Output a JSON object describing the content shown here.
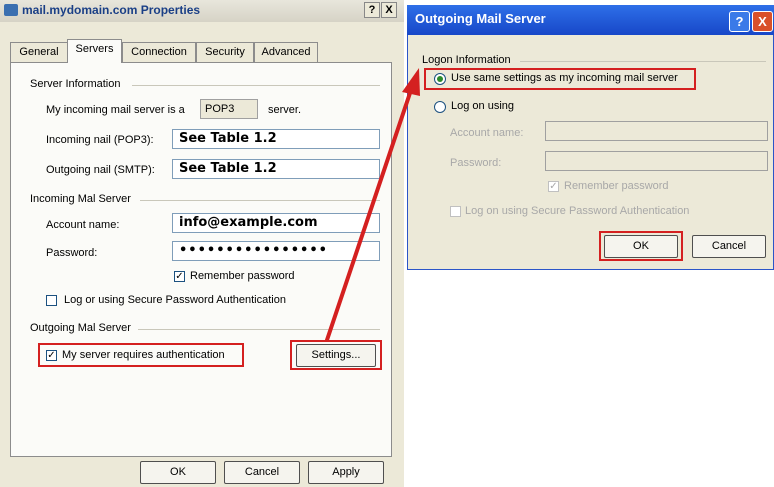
{
  "properties_dialog": {
    "title": "mail.mydomain.com Properties",
    "help_btn": "?",
    "close_btn": "X",
    "tabs": [
      "General",
      "Servers",
      "Connection",
      "Security",
      "Advanced"
    ],
    "active_tab": "Servers",
    "server_info": {
      "group": "Server Information",
      "incoming_type_prefix": "My incoming mail server is a",
      "incoming_type": "POP3",
      "incoming_type_suffix": "server.",
      "incoming_label": "Incoming nail (POP3):",
      "incoming_value": "See Table 1.2",
      "outgoing_label": "Outgoing nail (SMTP):",
      "outgoing_value": "See Table 1.2"
    },
    "incoming_server": {
      "group": "Incoming Mal Server",
      "account_label": "Account name:",
      "account_value": "info@example.com",
      "password_label": "Password:",
      "password_value": "••••••••••••••••",
      "remember_label": "Remember password",
      "remember_checked": true,
      "spa_label": "Log or using Secure Password Authentication",
      "spa_checked": false
    },
    "outgoing_server": {
      "group": "Outgoing Mal Server",
      "auth_label": "My server requires authentication",
      "auth_checked": true,
      "settings_btn": "Settings..."
    },
    "buttons": {
      "ok": "OK",
      "cancel": "Cancel",
      "apply": "Apply"
    }
  },
  "outgoing_dialog": {
    "title": "Outgoing Mail Server",
    "help_btn": "?",
    "close_btn": "X",
    "group": "Logon Information",
    "use_same_label": "Use same settings as my incoming mail server",
    "use_same_selected": true,
    "log_on_label": "Log on using",
    "account_label": "Account name:",
    "account_value": "",
    "password_label": "Password:",
    "password_value": "",
    "remember_label": "Remember password",
    "remember_checked": true,
    "spa_label": "Log on using Secure Password Authentication",
    "ok_btn": "OK",
    "cancel_btn": "Cancel"
  },
  "colors": {
    "highlight": "#d42020",
    "arrow": "#d42020",
    "xp_title": "#1747c8"
  }
}
